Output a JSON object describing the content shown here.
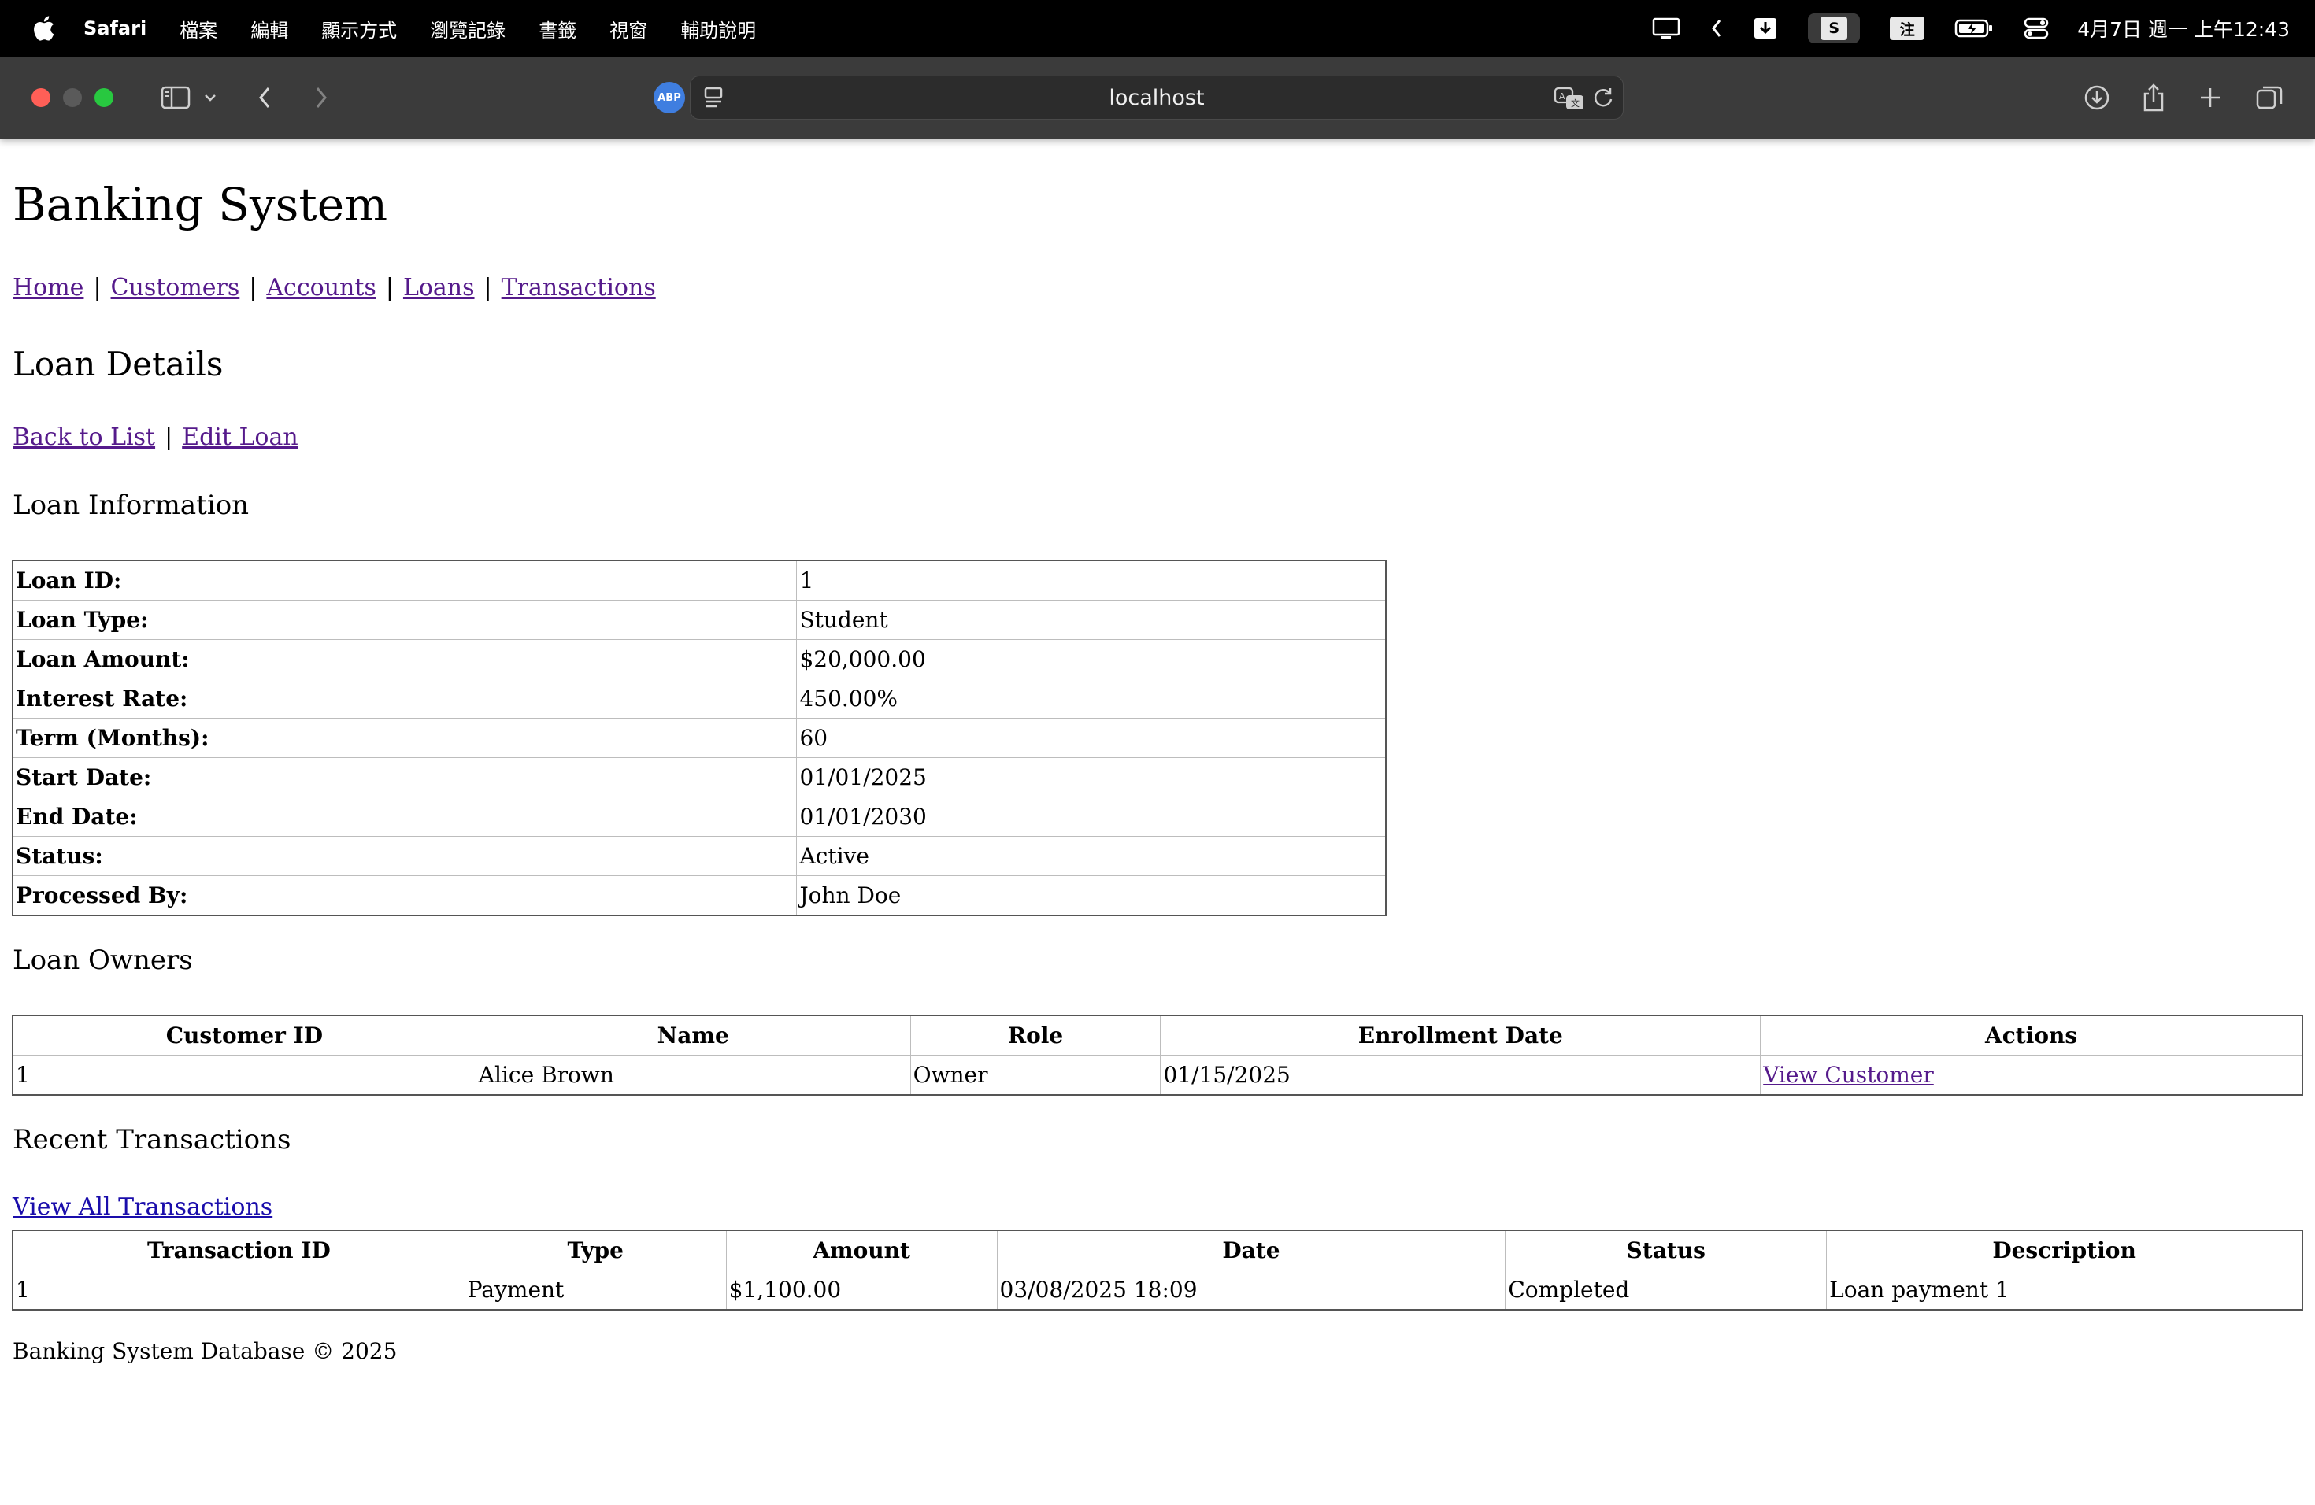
{
  "menubar": {
    "app_name": "Safari",
    "items": [
      "檔案",
      "編輯",
      "顯示方式",
      "瀏覽記錄",
      "書籤",
      "視窗",
      "輔助說明"
    ],
    "status_s": "S",
    "status_zhu": "注",
    "clock": "4月7日 週一 上午12:43"
  },
  "browser": {
    "url": "localhost",
    "abp_label": "ABP"
  },
  "site": {
    "title": "Banking System",
    "nav": [
      "Home",
      "Customers",
      "Accounts",
      "Loans",
      "Transactions"
    ],
    "nav_sep": "|"
  },
  "page": {
    "title": "Loan Details",
    "back_label": "Back to List",
    "edit_label": "Edit Loan",
    "sep": "|"
  },
  "loan_info": {
    "heading": "Loan Information",
    "rows": [
      {
        "label": "Loan ID:",
        "value": "1"
      },
      {
        "label": "Loan Type:",
        "value": "Student"
      },
      {
        "label": "Loan Amount:",
        "value": "$20,000.00"
      },
      {
        "label": "Interest Rate:",
        "value": "450.00%"
      },
      {
        "label": "Term (Months):",
        "value": "60"
      },
      {
        "label": "Start Date:",
        "value": "01/01/2025"
      },
      {
        "label": "End Date:",
        "value": "01/01/2030"
      },
      {
        "label": "Status:",
        "value": "Active"
      },
      {
        "label": "Processed By:",
        "value": "John Doe"
      }
    ]
  },
  "owners": {
    "heading": "Loan Owners",
    "columns": [
      "Customer ID",
      "Name",
      "Role",
      "Enrollment Date",
      "Actions"
    ],
    "rows": [
      {
        "customer_id": "1",
        "name": "Alice Brown",
        "role": "Owner",
        "enrollment_date": "01/15/2025",
        "action": "View Customer"
      }
    ]
  },
  "transactions": {
    "heading": "Recent Transactions",
    "view_all": "View All Transactions",
    "columns": [
      "Transaction ID",
      "Type",
      "Amount",
      "Date",
      "Status",
      "Description"
    ],
    "rows": [
      {
        "id": "1",
        "type": "Payment",
        "amount": "$1,100.00",
        "date": "03/08/2025 18:09",
        "status": "Completed",
        "description": "Loan payment 1"
      }
    ]
  },
  "footer": {
    "text": "Banking System Database © 2025"
  }
}
